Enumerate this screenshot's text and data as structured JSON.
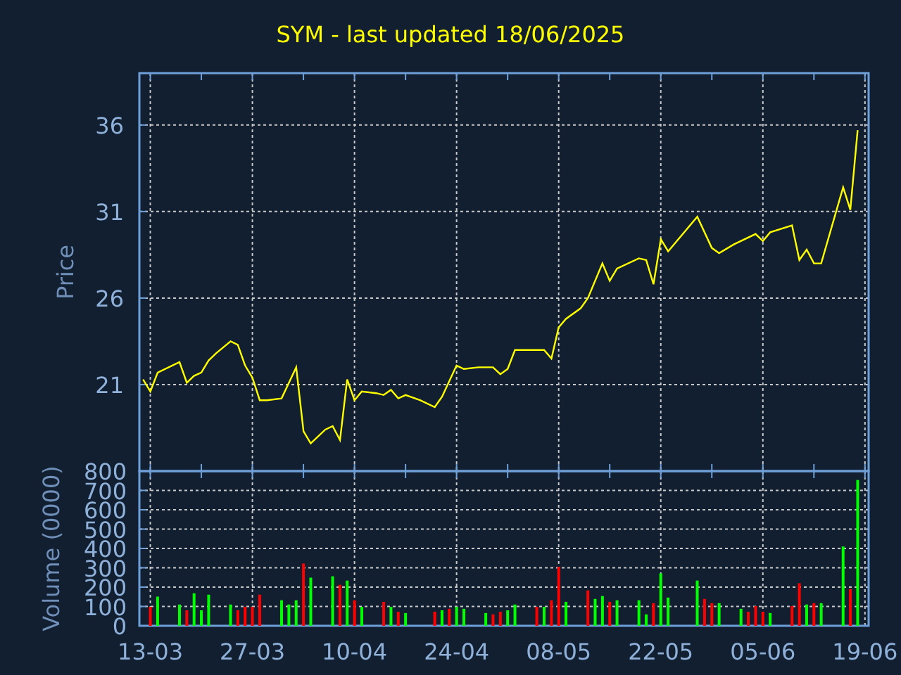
{
  "title": "SYM - last updated 18/06/2025",
  "price_panel": {
    "chart_data": {
      "type": "line",
      "ylabel": "Price",
      "series": [
        {
          "color": "#ffff00",
          "values": [
            21.3,
            20.6,
            21.7,
            null,
            null,
            22.3,
            21.1,
            21.5,
            21.7,
            22.4,
            22.8,
            null,
            23.5,
            23.3,
            22.1,
            21.4,
            20.1,
            20.1,
            null,
            20.2,
            21.1,
            22.0,
            18.3,
            17.6,
            null,
            18.4,
            18.6,
            17.8,
            21.3,
            20.1,
            20.6,
            null,
            20.5,
            20.4,
            20.7,
            20.2,
            20.4,
            null,
            20.1,
            null,
            19.7,
            20.3,
            null,
            22.1,
            21.9,
            null,
            22.0,
            null,
            22.0,
            21.6,
            21.9,
            23.0,
            null,
            23.0,
            null,
            23.0,
            22.5,
            24.3,
            24.8,
            null,
            25.4,
            26.0,
            null,
            28.0,
            27.0,
            27.7,
            null,
            null,
            28.3,
            28.2,
            26.8,
            29.4,
            28.7,
            null,
            null,
            null,
            30.7,
            null,
            28.9,
            28.6,
            null,
            29.1,
            null,
            null,
            29.7,
            29.3,
            29.8,
            null,
            null,
            30.2,
            28.2,
            28.8,
            28.0,
            28.0,
            null,
            null,
            32.4,
            31.1,
            35.7,
            null
          ]
        }
      ],
      "ylim": [
        16,
        39
      ],
      "yticks": [
        21,
        26,
        31,
        36
      ],
      "grid": true
    }
  },
  "volume_panel": {
    "chart_data": {
      "type": "bar",
      "ylabel": "Volume (0000)",
      "categories": [
        null,
        "13-03",
        null,
        null,
        null,
        null,
        null,
        null,
        null,
        null,
        null,
        null,
        null,
        null,
        null,
        "27-03",
        null,
        null,
        null,
        null,
        null,
        null,
        null,
        null,
        null,
        null,
        null,
        null,
        null,
        "10-04",
        null,
        null,
        null,
        null,
        null,
        null,
        null,
        null,
        null,
        null,
        null,
        null,
        null,
        "24-04",
        null,
        null,
        null,
        null,
        null,
        null,
        null,
        null,
        null,
        null,
        null,
        null,
        null,
        "08-05",
        null,
        null,
        null,
        null,
        null,
        null,
        null,
        null,
        null,
        null,
        null,
        null,
        null,
        "22-05",
        null,
        null,
        null,
        null,
        null,
        null,
        null,
        null,
        null,
        null,
        null,
        null,
        null,
        "05-06",
        null,
        null,
        null,
        null,
        null,
        null,
        null,
        null,
        null,
        null,
        null,
        null,
        null,
        "19-06"
      ],
      "series": [
        {
          "color": "#00ff00",
          "values": [
            null,
            null,
            151,
            null,
            null,
            110,
            null,
            168,
            80,
            161,
            null,
            null,
            110,
            null,
            null,
            null,
            null,
            null,
            null,
            132,
            110,
            132,
            null,
            249,
            null,
            null,
            256,
            null,
            234,
            null,
            98,
            null,
            null,
            null,
            98,
            null,
            66,
            null,
            null,
            null,
            null,
            80,
            null,
            98,
            88,
            null,
            null,
            66,
            null,
            null,
            80,
            110,
            null,
            null,
            null,
            98,
            null,
            null,
            124,
            null,
            null,
            null,
            139,
            154,
            null,
            132,
            null,
            null,
            132,
            59,
            null,
            271,
            146,
            null,
            null,
            null,
            234,
            null,
            null,
            117,
            null,
            null,
            88,
            null,
            null,
            null,
            66,
            null,
            null,
            null,
            null,
            110,
            null,
            117,
            null,
            null,
            410,
            null,
            754,
            null
          ]
        },
        {
          "color": "#ff0000",
          "values": [
            null,
            98,
            null,
            null,
            null,
            null,
            80,
            null,
            null,
            null,
            null,
            null,
            null,
            80,
            98,
            98,
            161,
            null,
            null,
            null,
            null,
            null,
            322,
            null,
            null,
            null,
            null,
            212,
            null,
            132,
            null,
            null,
            null,
            124,
            null,
            73,
            null,
            null,
            null,
            null,
            73,
            null,
            88,
            null,
            null,
            null,
            null,
            null,
            59,
            73,
            null,
            null,
            null,
            null,
            98,
            null,
            132,
            305,
            null,
            null,
            null,
            183,
            null,
            null,
            124,
            null,
            null,
            null,
            null,
            null,
            117,
            null,
            null,
            null,
            null,
            null,
            null,
            139,
            117,
            null,
            null,
            null,
            null,
            73,
            102,
            73,
            null,
            null,
            null,
            102,
            220,
            null,
            117,
            null,
            null,
            null,
            null,
            190,
            null,
            null
          ]
        }
      ],
      "ylim": [
        0,
        800
      ],
      "yticks": [
        0,
        100,
        200,
        300,
        400,
        500,
        600,
        700,
        800
      ],
      "grid": true
    }
  }
}
